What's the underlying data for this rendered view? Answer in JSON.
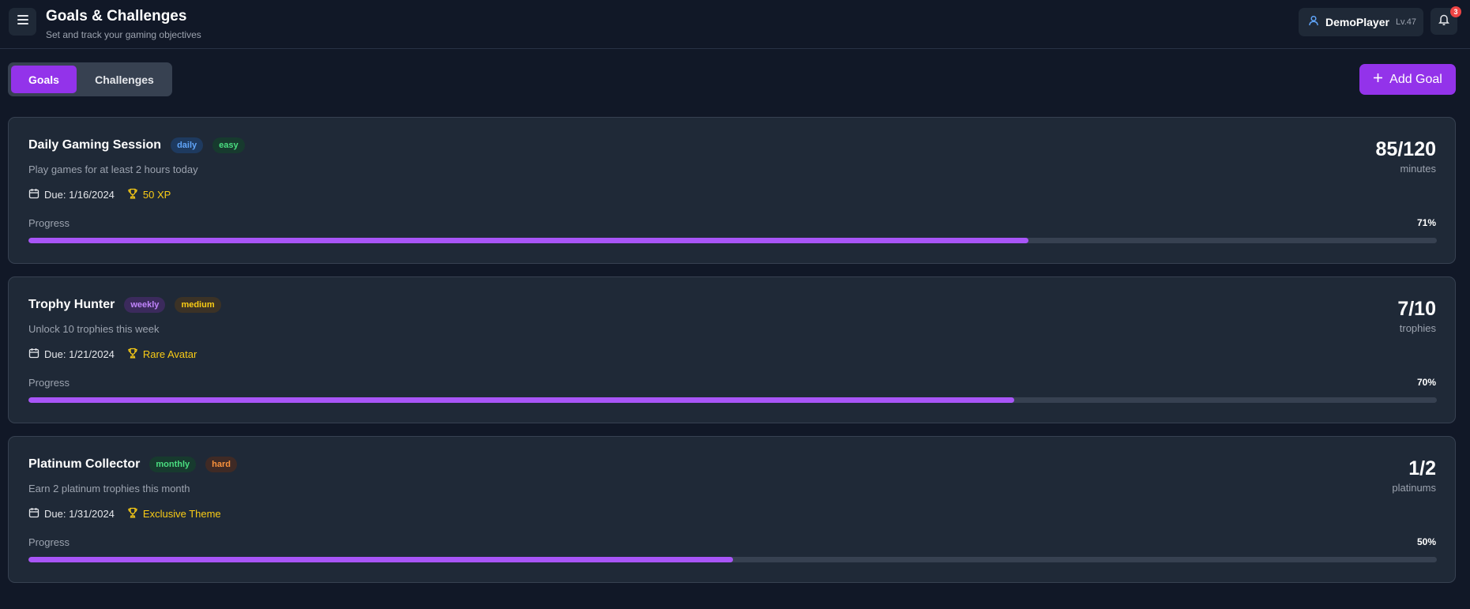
{
  "header": {
    "title": "Goals & Challenges",
    "subtitle": "Set and track your gaming objectives",
    "menu_icon": "hamburger-menu-icon",
    "user": {
      "name": "DemoPlayer",
      "level": "Lv.47"
    },
    "notifications": {
      "count": "3"
    }
  },
  "tabs": [
    {
      "label": "Goals",
      "active": true
    },
    {
      "label": "Challenges",
      "active": false
    }
  ],
  "add_goal_label": "Add Goal",
  "goals": [
    {
      "title": "Daily Gaming Session",
      "tags": [
        {
          "label": "daily",
          "color": "#60a5fa",
          "bg": "#1e3a5f"
        },
        {
          "label": "easy",
          "color": "#4ade80",
          "bg": "#173a2e"
        }
      ],
      "description": "Play games for at least 2 hours today",
      "due": "Due: 1/16/2024",
      "reward": "50 XP",
      "count": "85/120",
      "unit": "minutes",
      "progress_label": "Progress",
      "progress_text": "71%",
      "progress": 0.71
    },
    {
      "title": "Trophy Hunter",
      "tags": [
        {
          "label": "weekly",
          "color": "#c084fc",
          "bg": "#3b2a5c"
        },
        {
          "label": "medium",
          "color": "#facc15",
          "bg": "#3b3226"
        }
      ],
      "description": "Unlock 10 trophies this week",
      "due": "Due: 1/21/2024",
      "reward": "Rare Avatar",
      "count": "7/10",
      "unit": "trophies",
      "progress_label": "Progress",
      "progress_text": "70%",
      "progress": 0.7
    },
    {
      "title": "Platinum Collector",
      "tags": [
        {
          "label": "monthly",
          "color": "#4ade80",
          "bg": "#173a2e"
        },
        {
          "label": "hard",
          "color": "#fb923c",
          "bg": "#3f2a25"
        }
      ],
      "description": "Earn 2 platinum trophies this month",
      "due": "Due: 1/31/2024",
      "reward": "Exclusive Theme",
      "count": "1/2",
      "unit": "platinums",
      "progress_label": "Progress",
      "progress_text": "50%",
      "progress": 0.5
    }
  ],
  "colors": {
    "accent": "#9333ea",
    "progress_fill": "#a855f7",
    "reward": "#facc15",
    "background": "#111827",
    "card": "#1f2937"
  }
}
